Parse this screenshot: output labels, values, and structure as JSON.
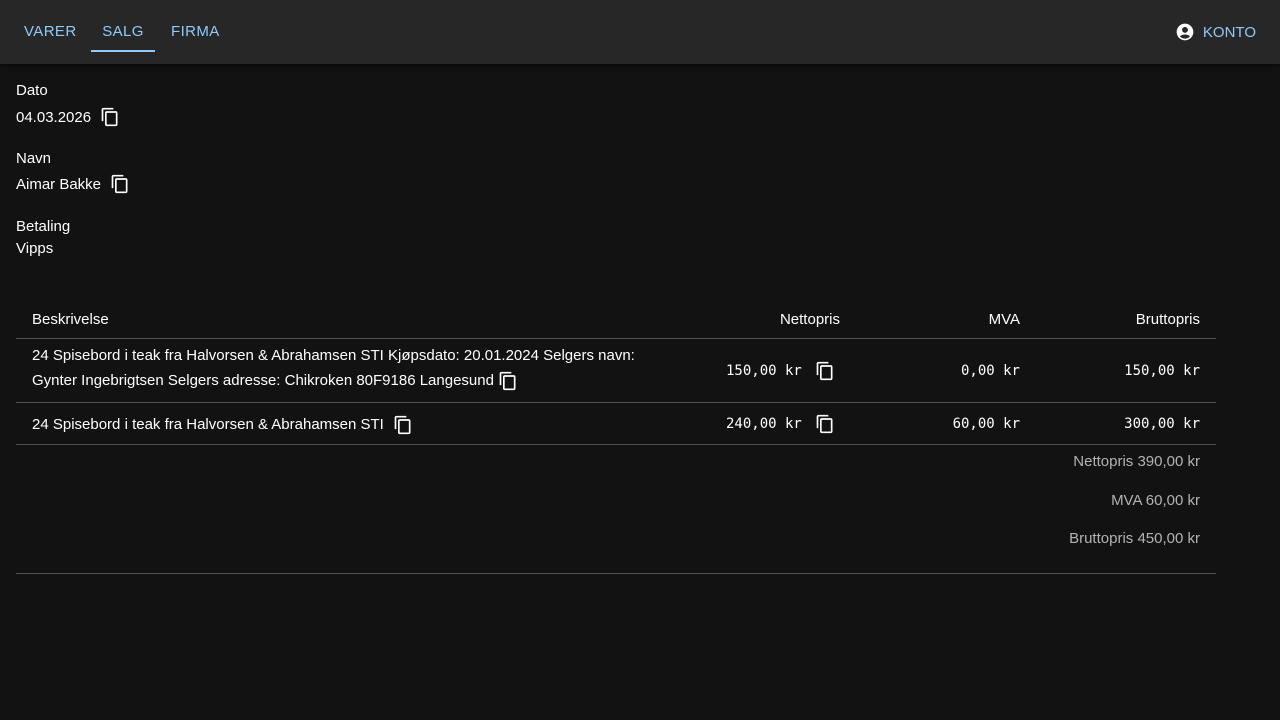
{
  "nav": {
    "tabs": [
      {
        "label": "VARER"
      },
      {
        "label": "SALG"
      },
      {
        "label": "FIRMA"
      }
    ],
    "account_label": "KONTO"
  },
  "details": {
    "date_label": "Dato",
    "date_value": "04.03.2026",
    "name_label": "Navn",
    "name_value": "Aimar Bakke",
    "payment_label": "Betaling",
    "payment_value": "Vipps"
  },
  "table": {
    "headers": {
      "description": "Beskrivelse",
      "net": "Nettopris",
      "vat": "MVA",
      "gross": "Bruttopris"
    },
    "rows": [
      {
        "description_line1": "24 Spisebord i teak fra Halvorsen & Abrahamsen STI Kjøpsdato: 20.01.2024 Selgers navn:",
        "description_line2": "Gynter Ingebrigtsen Selgers adresse: Chikroken 80F9186 Langesund",
        "net": "150,00 kr",
        "vat": "0,00 kr",
        "gross": "150,00 kr"
      },
      {
        "description_line1": "24 Spisebord i teak fra Halvorsen & Abrahamsen STI",
        "net": "240,00 kr",
        "vat": "60,00 kr",
        "gross": "300,00 kr"
      }
    ],
    "totals": {
      "net": "Nettopris 390,00 kr",
      "vat": "MVA 60,00 kr",
      "gross": "Bruttopris 450,00 kr"
    }
  },
  "icons": {
    "copy": "copy-icon",
    "account": "account-circle-icon"
  },
  "colors": {
    "accent": "#90caf9",
    "background": "#121212",
    "appbar": "#272727"
  }
}
